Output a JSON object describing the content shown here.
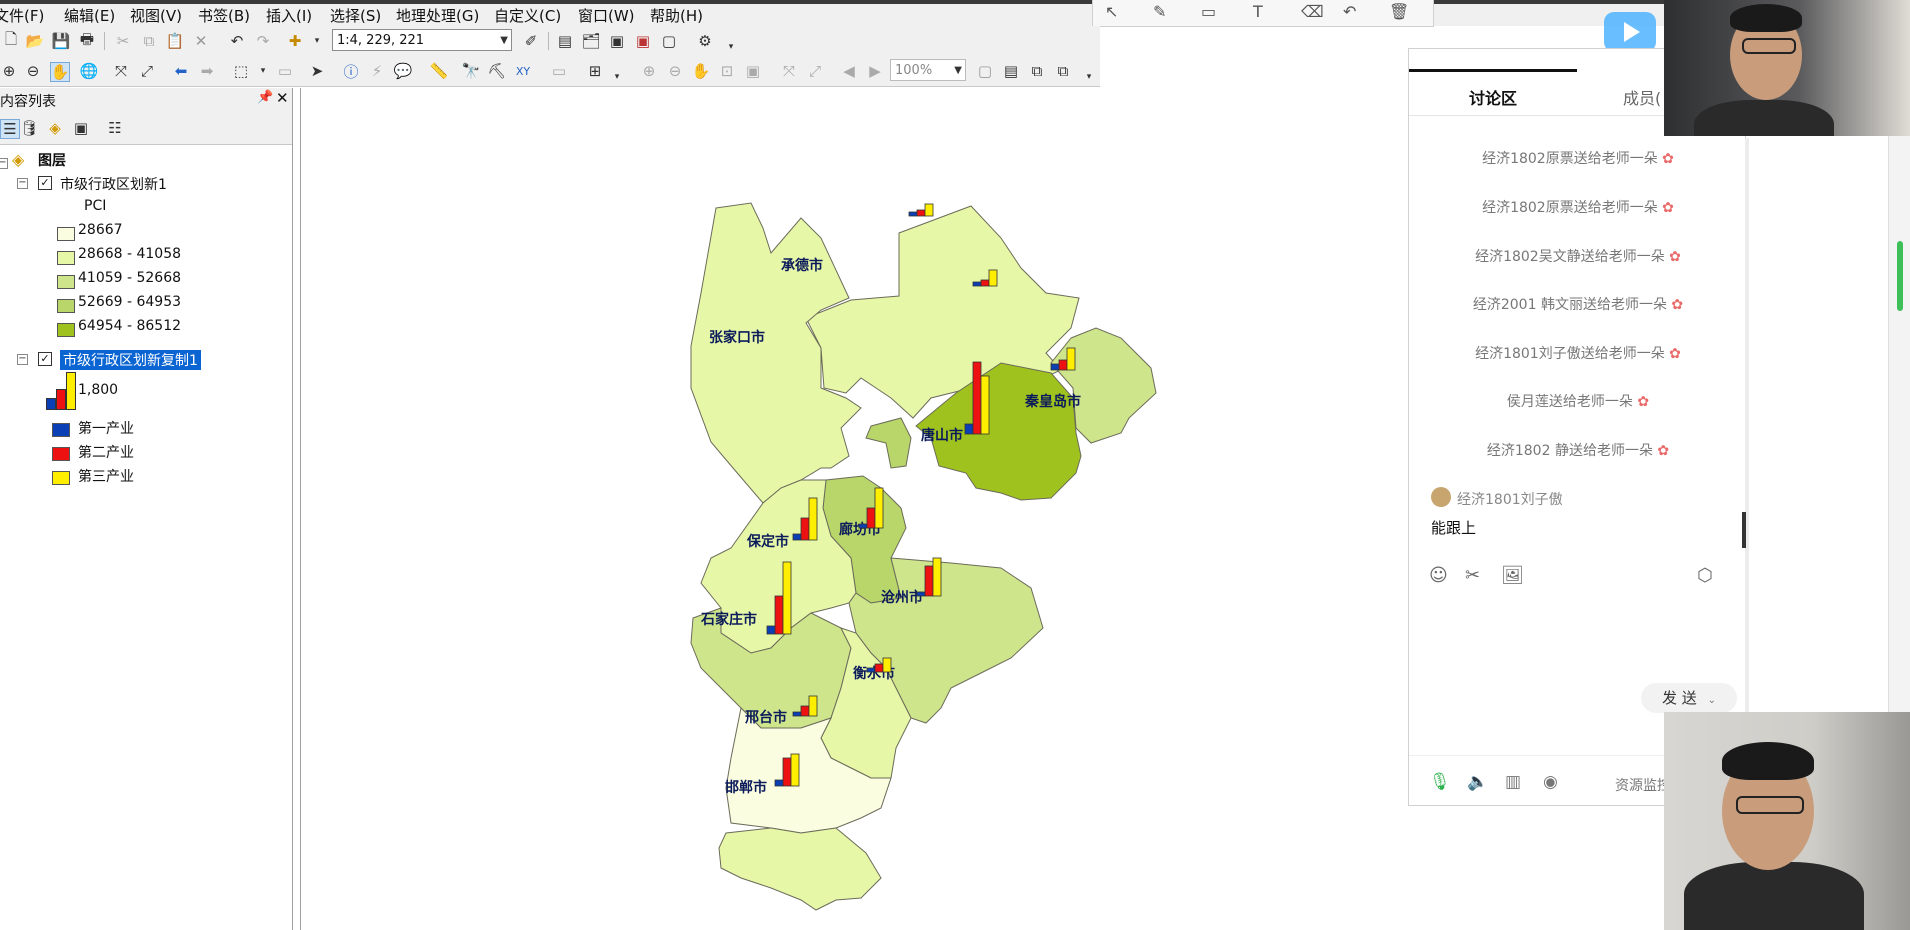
{
  "menu": [
    "文件(F)",
    "编辑(E)",
    "视图(V)",
    "书签(B)",
    "插入(I)",
    "选择(S)",
    "地理处理(G)",
    "自定义(C)",
    "窗口(W)",
    "帮助(H)"
  ],
  "toolbar": {
    "scale": "1:4, 229, 221",
    "zoom": "100%"
  },
  "toc": {
    "title": "内容列表",
    "group": "图层",
    "layer1": {
      "name": "市级行政区划新1",
      "field": "PCI",
      "classes": [
        {
          "label": "28667",
          "color": "#fbfde0"
        },
        {
          "label": "28668 - 41058",
          "color": "#e7f7a8"
        },
        {
          "label": "41059 - 52668",
          "color": "#cfe58c"
        },
        {
          "label": "52669 - 64953",
          "color": "#b9d66a"
        },
        {
          "label": "64954 - 86512",
          "color": "#9fc21e"
        }
      ]
    },
    "layer2": {
      "name": "市级行政区划新复制1",
      "chart_max": "1,800",
      "series": [
        {
          "label": "第一产业",
          "color": "#0b3fb5"
        },
        {
          "label": "第二产业",
          "color": "#ee1111"
        },
        {
          "label": "第三产业",
          "color": "#ffee00"
        }
      ]
    }
  },
  "map": {
    "cities": [
      "承德市",
      "张家口市",
      "秦皇岛市",
      "唐山市",
      "廊坊市",
      "保定市",
      "沧州市",
      "石家庄市",
      "衡水市",
      "邢台市",
      "邯郸市"
    ]
  },
  "chat": {
    "tab_discussion": "讨论区",
    "tab_members": "成员(",
    "gifts": [
      "经济1802原票送给老师一朵",
      "经济1802原票送给老师一朵",
      "经济1802吴文静送给老师一朵",
      "经济2001 韩文丽送给老师一朵",
      "经济1801刘子傲送给老师一朵",
      "侯月莲送给老师一朵",
      "经济1802  静送给老师一朵"
    ],
    "user": "经济1801刘子傲",
    "message": "能跟上",
    "send": "发 送",
    "resource_monitor": "资源监控"
  }
}
